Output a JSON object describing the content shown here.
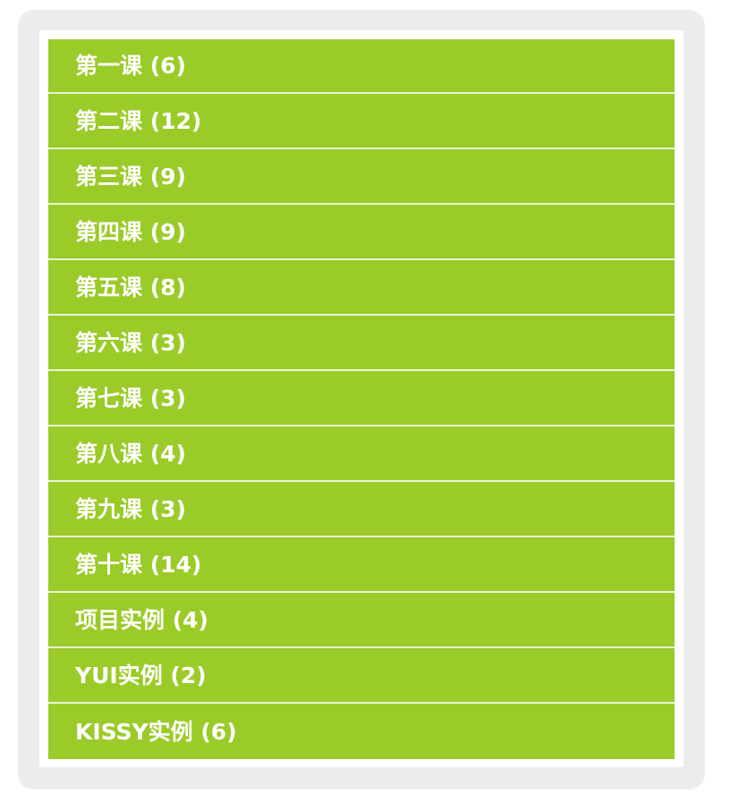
{
  "menu": {
    "items": [
      {
        "label": "第一课 (6)"
      },
      {
        "label": "第二课 (12)"
      },
      {
        "label": "第三课 (9)"
      },
      {
        "label": "第四课 (9)"
      },
      {
        "label": "第五课 (8)"
      },
      {
        "label": "第六课 (3)"
      },
      {
        "label": "第七课 (3)"
      },
      {
        "label": "第八课 (4)"
      },
      {
        "label": "第九课 (3)"
      },
      {
        "label": "第十课 (14)"
      },
      {
        "label": "项目实例 (4)"
      },
      {
        "label": "YUI实例 (2)"
      },
      {
        "label": "KISSY实例 (6)"
      }
    ]
  },
  "colors": {
    "item_background": "#9bcb28",
    "item_text": "#ffffff",
    "divider": "#e9f5d8",
    "frame": "#ececec",
    "panel": "#ffffff"
  }
}
